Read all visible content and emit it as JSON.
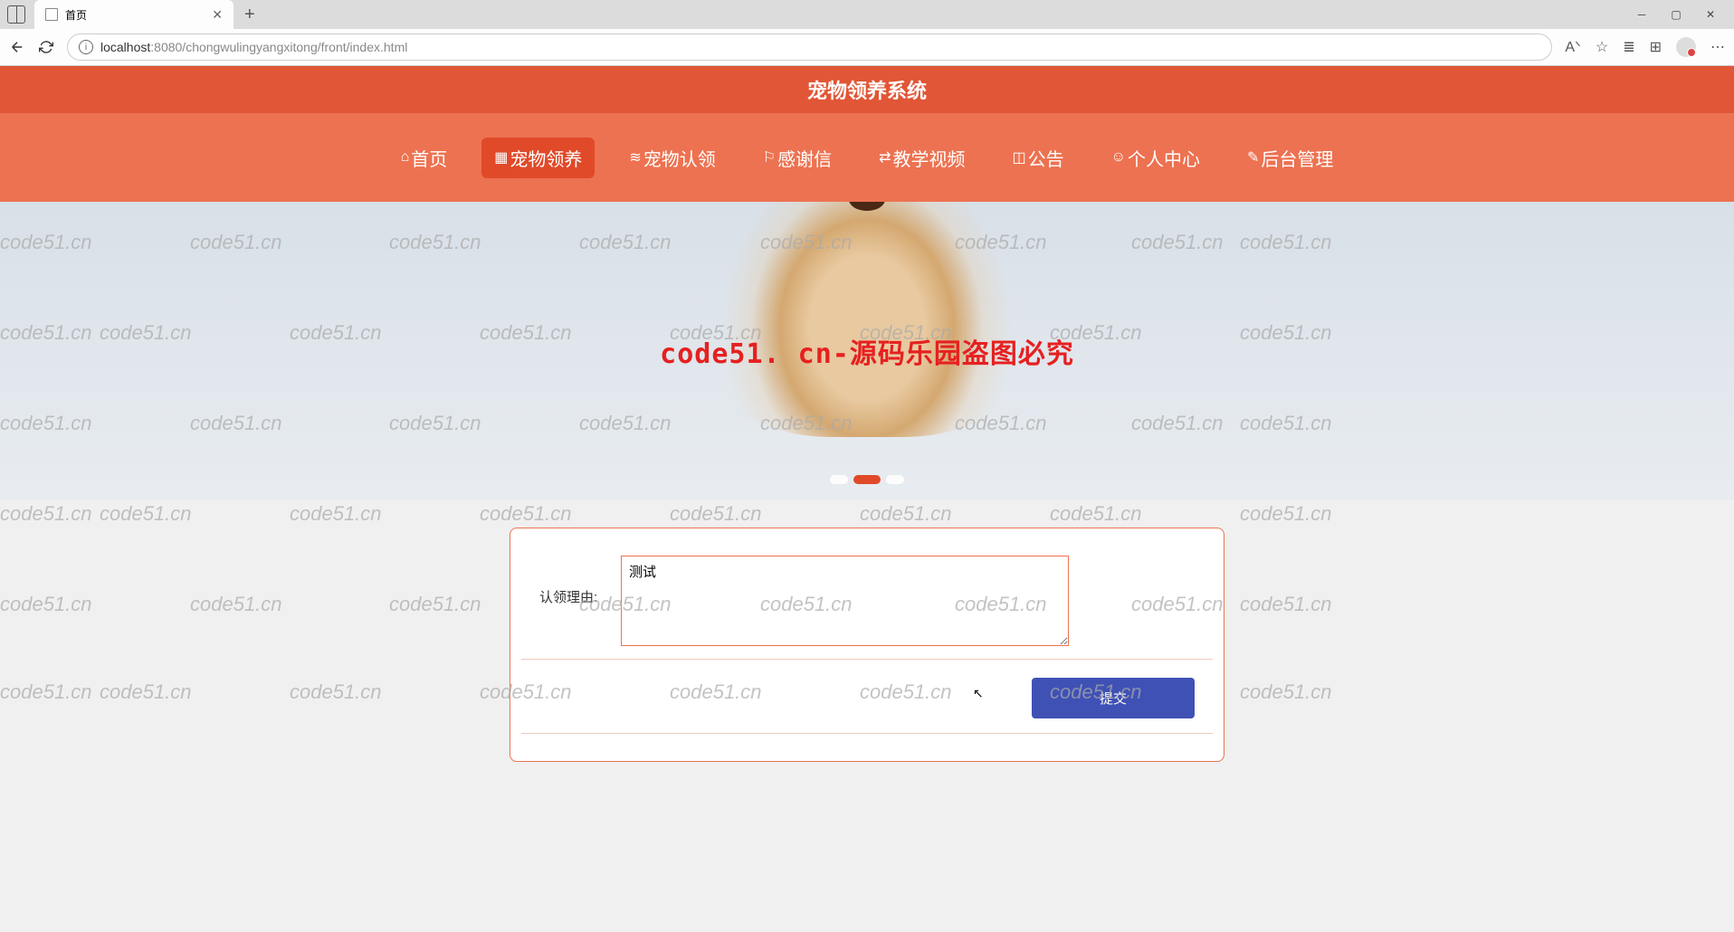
{
  "browser": {
    "tab_title": "首页",
    "url_host": "localhost",
    "url_port_path": ":8080/chongwulingyangxitong/front/index.html"
  },
  "header": {
    "title": "宠物领养系统"
  },
  "nav": {
    "items": [
      {
        "icon": "⌂",
        "label": "首页",
        "active": false
      },
      {
        "icon": "▦",
        "label": "宠物领养",
        "active": true
      },
      {
        "icon": "≋",
        "label": "宠物认领",
        "active": false
      },
      {
        "icon": "⚐",
        "label": "感谢信",
        "active": false
      },
      {
        "icon": "⇄",
        "label": "教学视频",
        "active": false
      },
      {
        "icon": "◫",
        "label": "公告",
        "active": false
      },
      {
        "icon": "☺",
        "label": "个人中心",
        "active": false
      },
      {
        "icon": "✎",
        "label": "后台管理",
        "active": false
      }
    ]
  },
  "banner": {
    "text": "code51. cn-源码乐园盗图必究",
    "active_dot": 1
  },
  "form": {
    "reason_label": "认领理由:",
    "reason_value": "测试",
    "submit_label": "提交"
  },
  "watermark": "code51.cn"
}
